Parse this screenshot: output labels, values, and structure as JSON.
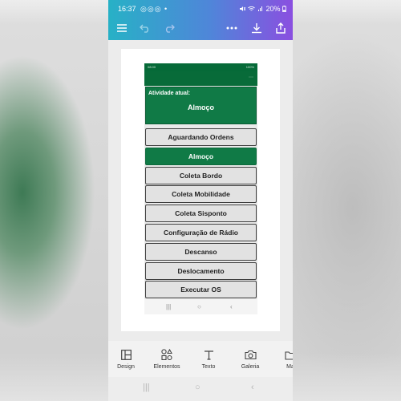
{
  "status_bar": {
    "time": "16:37",
    "notifications": "◎◎◎ •",
    "battery": "20%"
  },
  "editor_toolbar": {
    "menu_icon": "hamburger-icon",
    "undo_icon": "undo-icon",
    "redo_icon": "redo-icon",
    "more_icon": "more-horizontal-icon",
    "download_icon": "download-icon",
    "share_icon": "share-icon",
    "brand_gradient": [
      "#27b1c6",
      "#8a4fe0"
    ]
  },
  "app_screenshot": {
    "status_time": "08:00",
    "status_right": "100%",
    "current_activity_label": "Atividade atual:",
    "current_activity_value": "Almoço",
    "options": [
      {
        "label": "Aguardando Ordens",
        "selected": false
      },
      {
        "label": "Almoço",
        "selected": true
      },
      {
        "label": "Coleta Bordo",
        "selected": false
      },
      {
        "label": "Coleta Mobilidade",
        "selected": false
      },
      {
        "label": "Coleta Sisponto",
        "selected": false
      },
      {
        "label": "Configuração de Rádio",
        "selected": false
      },
      {
        "label": "Descanso",
        "selected": false
      },
      {
        "label": "Deslocamento",
        "selected": false
      },
      {
        "label": "Executar OS",
        "selected": false
      }
    ],
    "accent_color": "#107a46"
  },
  "bottom_tools": [
    {
      "label": "Design",
      "icon": "layout-icon"
    },
    {
      "label": "Elementos",
      "icon": "shapes-icon"
    },
    {
      "label": "Texto",
      "icon": "text-icon"
    },
    {
      "label": "Galeria",
      "icon": "camera-icon"
    },
    {
      "label": "Ma",
      "icon": "folder-icon"
    }
  ]
}
